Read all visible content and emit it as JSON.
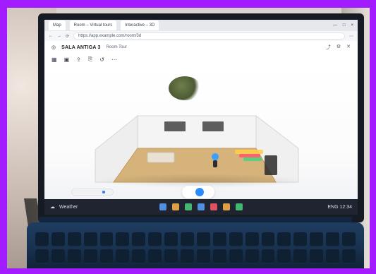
{
  "browser": {
    "tabs": [
      {
        "label": "Map"
      },
      {
        "label": "Room – Virtual tours"
      },
      {
        "label": "Interactive – 3D"
      }
    ],
    "url": "https://app.example.com/room/3d",
    "icons": [
      "back-icon",
      "forward-icon",
      "refresh-icon",
      "tab-close-icon",
      "window-controls-icon"
    ]
  },
  "app": {
    "title": "SALA ANTIGA 3",
    "subtitle": "Room Tour",
    "right_actions": [
      "share-icon",
      "settings-icon",
      "close-icon"
    ]
  },
  "toolbar": {
    "icons": [
      "menu-icon",
      "layout-icon",
      "upload-icon",
      "save-icon",
      "reset-icon",
      "more-icon"
    ]
  },
  "taskbar": {
    "left_text": "Weather",
    "right_text": "ENG 12:34",
    "icons": [
      "start-icon",
      "search-icon",
      "files-icon",
      "browser-icon",
      "mail-icon",
      "store-icon",
      "chat-icon"
    ]
  },
  "colors": {
    "frame": "#a21cff",
    "accent": "#2b8cff",
    "taskbar": "#1f2430",
    "laptop": "#183250"
  }
}
